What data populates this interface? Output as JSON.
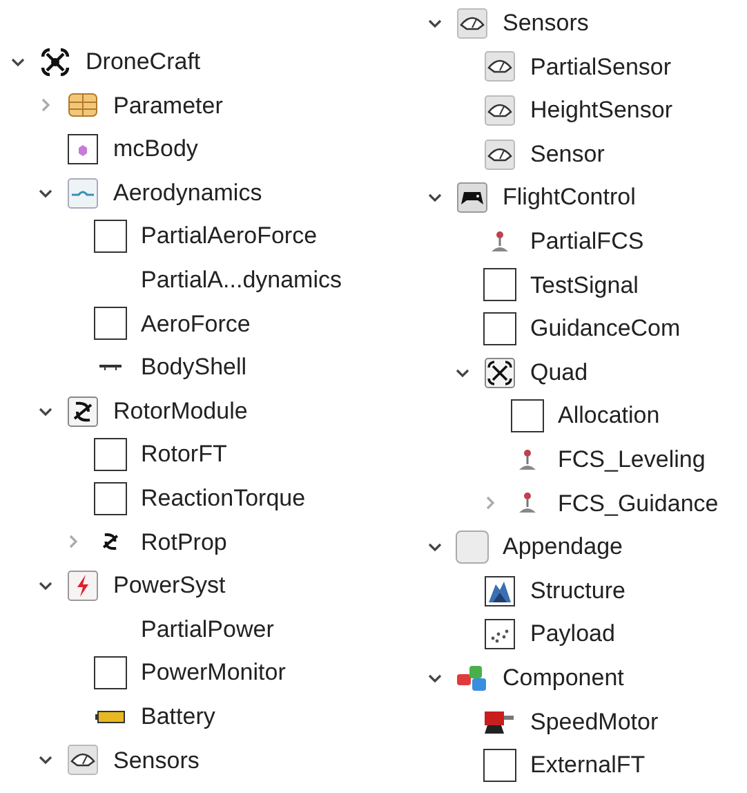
{
  "left_tree": [
    {
      "label": "DroneCraft",
      "kind": "drone",
      "expanded": true,
      "children": [
        {
          "label": "Parameter",
          "kind": "grid",
          "expanded": false
        },
        {
          "label": "mcBody",
          "kind": "body"
        },
        {
          "label": "Aerodynamics",
          "kind": "aero",
          "expanded": true,
          "children": [
            {
              "label": "PartialAeroForce",
              "kind": "block"
            },
            {
              "label": "PartialA...dynamics",
              "kind": "none"
            },
            {
              "label": "AeroForce",
              "kind": "block"
            },
            {
              "label": "BodyShell",
              "kind": "shell"
            }
          ]
        },
        {
          "label": "RotorModule",
          "kind": "rotor-boxed",
          "expanded": true,
          "children": [
            {
              "label": "RotorFT",
              "kind": "block"
            },
            {
              "label": "ReactionTorque",
              "kind": "block"
            },
            {
              "label": "RotProp",
              "kind": "rotor",
              "expanded": false
            }
          ]
        },
        {
          "label": "PowerSyst",
          "kind": "power",
          "expanded": true,
          "children": [
            {
              "label": "PartialPower",
              "kind": "none"
            },
            {
              "label": "PowerMonitor",
              "kind": "block"
            },
            {
              "label": "Battery",
              "kind": "battery"
            }
          ]
        },
        {
          "label": "Sensors",
          "kind": "sensor",
          "expanded": true
        }
      ]
    }
  ],
  "right_tree": [
    {
      "label": "Sensors",
      "kind": "sensor",
      "expanded": true,
      "children": [
        {
          "label": "PartialSensor",
          "kind": "sensor"
        },
        {
          "label": "HeightSensor",
          "kind": "sensor"
        },
        {
          "label": "Sensor",
          "kind": "sensor"
        }
      ]
    },
    {
      "label": "FlightControl",
      "kind": "gamepad",
      "expanded": true,
      "children": [
        {
          "label": "PartialFCS",
          "kind": "joystick"
        },
        {
          "label": "TestSignal",
          "kind": "block"
        },
        {
          "label": "GuidanceCom",
          "kind": "block"
        },
        {
          "label": "Quad",
          "kind": "quad",
          "expanded": true,
          "children": [
            {
              "label": "Allocation",
              "kind": "block"
            },
            {
              "label": "FCS_Leveling",
              "kind": "joystick"
            },
            {
              "label": "FCS_Guidance",
              "kind": "joystick",
              "expanded": false
            }
          ]
        }
      ]
    },
    {
      "label": "Appendage",
      "kind": "blank",
      "expanded": true,
      "children": [
        {
          "label": "Structure",
          "kind": "structure"
        },
        {
          "label": "Payload",
          "kind": "payload"
        }
      ]
    },
    {
      "label": "Component",
      "kind": "component",
      "expanded": true,
      "children": [
        {
          "label": "SpeedMotor",
          "kind": "motor"
        },
        {
          "label": "ExternalFT",
          "kind": "block"
        }
      ]
    }
  ]
}
